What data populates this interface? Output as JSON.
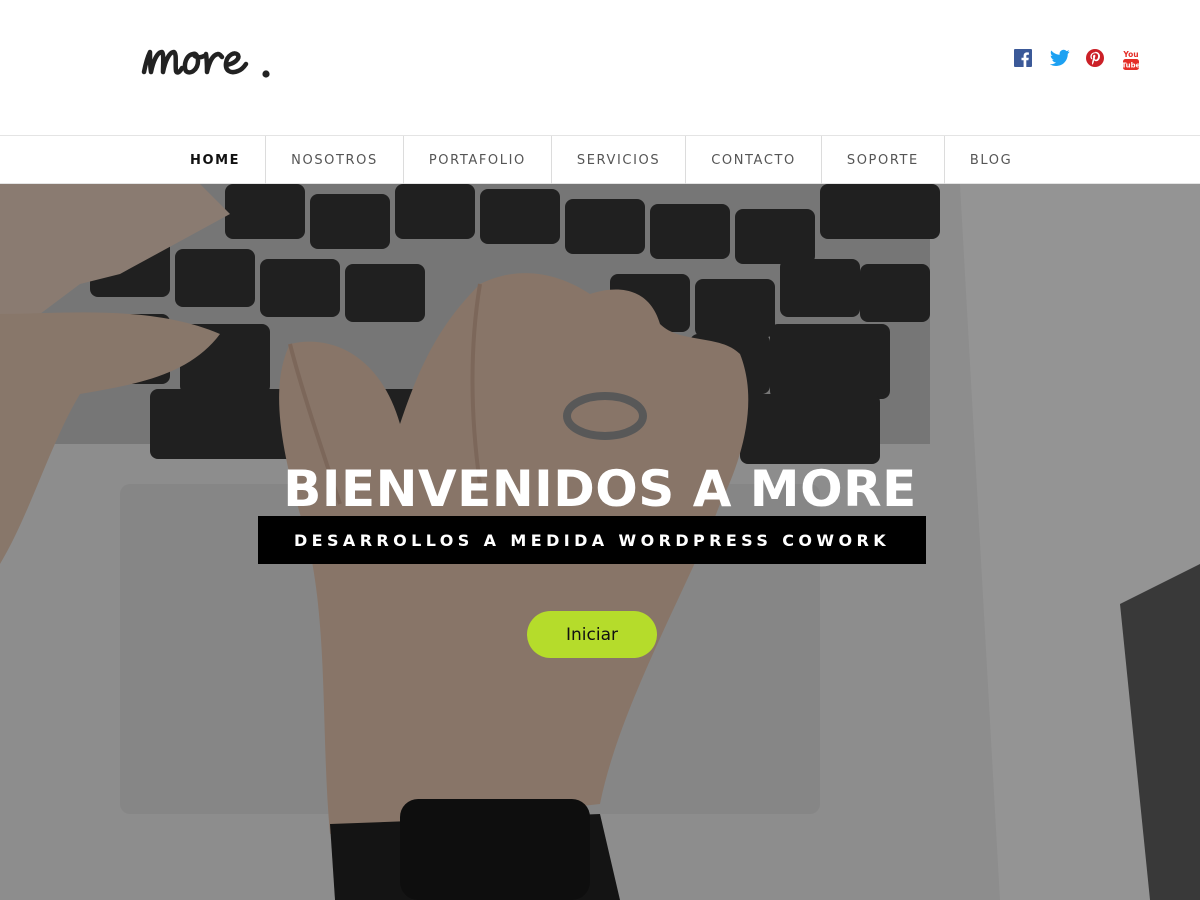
{
  "brand": {
    "logo_text": "more."
  },
  "social": [
    {
      "name": "facebook",
      "icon": "facebook-icon",
      "color": "#3b5998"
    },
    {
      "name": "twitter",
      "icon": "twitter-icon",
      "color": "#1da1f2"
    },
    {
      "name": "pinterest",
      "icon": "pinterest-icon",
      "color": "#cb2027"
    },
    {
      "name": "youtube",
      "icon": "youtube-icon",
      "color": "#e52d27"
    }
  ],
  "nav": {
    "items": [
      {
        "label": "HOME",
        "active": true
      },
      {
        "label": "NOSOTROS",
        "active": false
      },
      {
        "label": "PORTAFOLIO",
        "active": false
      },
      {
        "label": "SERVICIOS",
        "active": false
      },
      {
        "label": "CONTACTO",
        "active": false
      },
      {
        "label": "SOPORTE",
        "active": false
      },
      {
        "label": "BLOG",
        "active": false
      }
    ]
  },
  "hero": {
    "title": "BIENVENIDOS A MORE",
    "subtitle": "DESARROLLOS A MEDIDA WORDPRESS COWORK",
    "button_label": "Iniciar",
    "button_color": "#b5dc2b"
  }
}
